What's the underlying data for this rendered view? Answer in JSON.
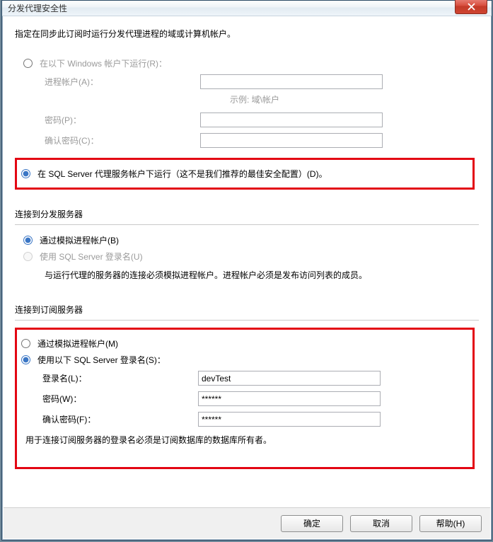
{
  "titlebar": {
    "title": "分发代理安全性"
  },
  "intro": "指定在同步此订阅时运行分发代理进程的域或计算机帐户。",
  "runAs": {
    "windows_label": "在以下 Windows 帐户下运行(R)：",
    "process_account_label": "进程帐户(A)：",
    "process_account_value": "",
    "example_hint": "示例: 域\\帐户",
    "password_label": "密码(P)：",
    "password_value": "",
    "confirm_label": "确认密码(C)：",
    "confirm_value": "",
    "sql_agent_label": "在 SQL Server 代理服务帐户下运行（这不是我们推荐的最佳安全配置）(D)。"
  },
  "distributor": {
    "section_title": "连接到分发服务器",
    "impersonate_label": "通过模拟进程帐户(B)",
    "sql_login_label": "使用 SQL Server 登录名(U)",
    "note": "与运行代理的服务器的连接必须模拟进程帐户。进程帐户必须是发布访问列表的成员。"
  },
  "subscriber": {
    "section_title": "连接到订阅服务器",
    "impersonate_label": "通过模拟进程帐户(M)",
    "sql_login_label": "使用以下 SQL Server 登录名(S)：",
    "login_label": "登录名(L)：",
    "login_value": "devTest",
    "password_label": "密码(W)：",
    "password_value": "******",
    "confirm_label": "确认密码(F)：",
    "confirm_value": "******",
    "note": "用于连接订阅服务器的登录名必须是订阅数据库的数据库所有者。"
  },
  "footer": {
    "ok": "确定",
    "cancel": "取消",
    "help": "帮助(H)"
  }
}
